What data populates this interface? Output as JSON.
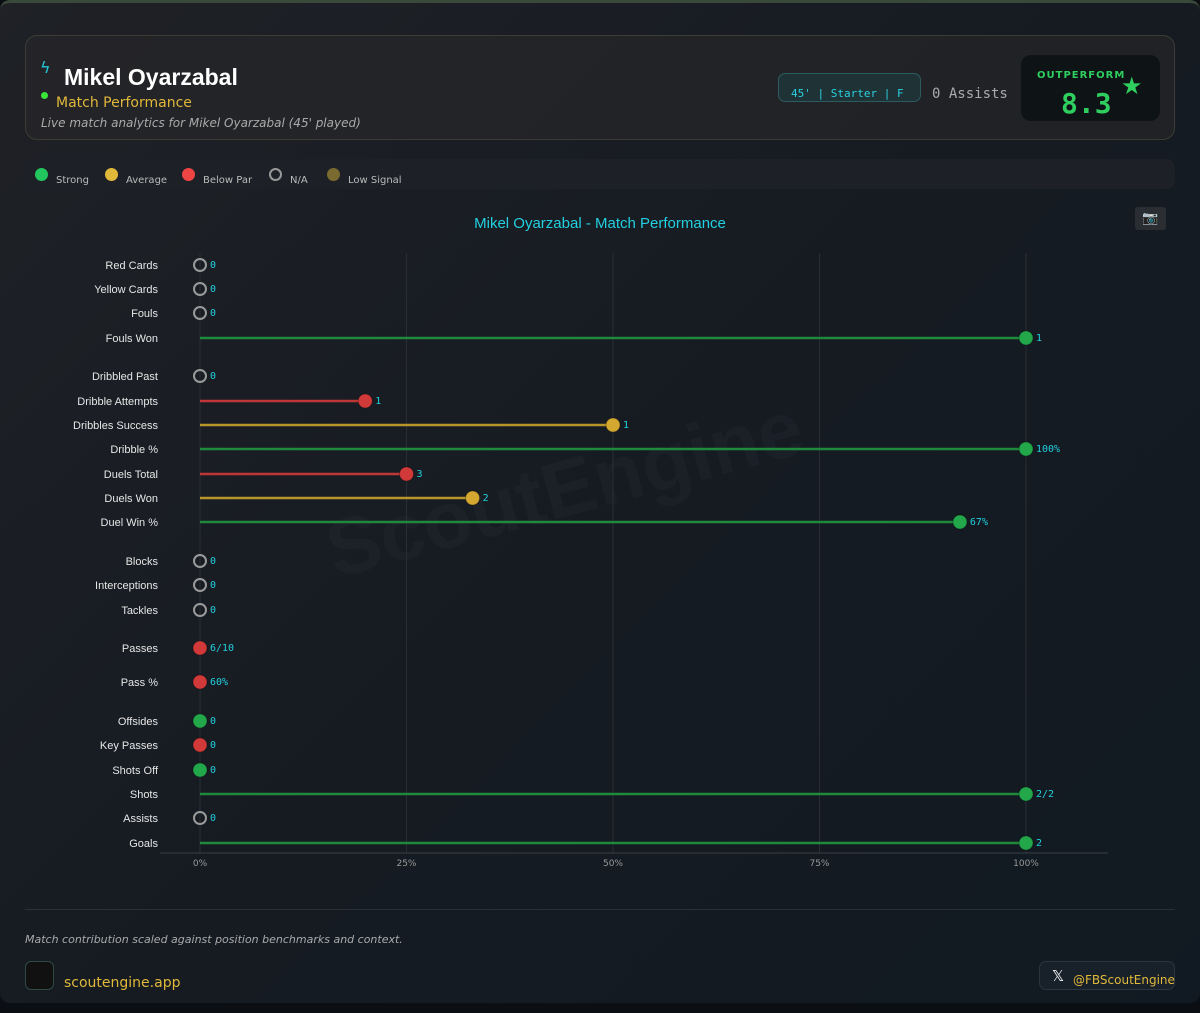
{
  "header": {
    "player": "Mikel Oyarzabal",
    "subtitle": "Match Performance",
    "description": "Live match analytics for Mikel Oyarzabal (45' played)",
    "badge": "45' | Starter | F",
    "assists": "0 Assists",
    "rating_label": "OUTPERFORM",
    "rating": "8.3",
    "icons": [
      "bolt-icon",
      "star-icon"
    ]
  },
  "legend": [
    {
      "label": "Strong",
      "color": "#22c55e"
    },
    {
      "label": "Average",
      "color": "#e0b83a"
    },
    {
      "label": "Below Par",
      "color": "#ef4444"
    },
    {
      "label": "N/A",
      "color": "hollow"
    },
    {
      "label": "Low Signal",
      "color": "#7a6a30"
    }
  ],
  "chart_data": {
    "type": "lollipop",
    "title": "Mikel Oyarzabal - Match Performance",
    "xlim": [
      0,
      100
    ],
    "xticks": [
      "0%",
      "25%",
      "50%",
      "75%",
      "100%"
    ],
    "grid": true,
    "rows": [
      {
        "label": "Red Cards",
        "pct": 0,
        "text": "0",
        "status": "na"
      },
      {
        "label": "Yellow Cards",
        "pct": 0,
        "text": "0",
        "status": "na"
      },
      {
        "label": "Fouls",
        "pct": 0,
        "text": "0",
        "status": "na"
      },
      {
        "label": "Fouls Won",
        "pct": 100,
        "text": "1",
        "status": "strong"
      },
      {
        "label": "Dribbled Past",
        "pct": 0,
        "text": "0",
        "status": "na"
      },
      {
        "label": "Dribble Attempts",
        "pct": 20,
        "text": "1",
        "status": "below"
      },
      {
        "label": "Dribbles Success",
        "pct": 50,
        "text": "1",
        "status": "average"
      },
      {
        "label": "Dribble %",
        "pct": 100,
        "text": "100%",
        "status": "strong"
      },
      {
        "label": "Duels Total",
        "pct": 25,
        "text": "3",
        "status": "below"
      },
      {
        "label": "Duels Won",
        "pct": 33,
        "text": "2",
        "status": "average"
      },
      {
        "label": "Duel Win %",
        "pct": 92,
        "text": "67%",
        "status": "strong"
      },
      {
        "label": "Blocks",
        "pct": 0,
        "text": "0",
        "status": "na"
      },
      {
        "label": "Interceptions",
        "pct": 0,
        "text": "0",
        "status": "na"
      },
      {
        "label": "Tackles",
        "pct": 0,
        "text": "0",
        "status": "na"
      },
      {
        "label": "Passes",
        "pct": 0,
        "text": "6/10",
        "status": "below"
      },
      {
        "label": "Pass %",
        "pct": 0,
        "text": "60%",
        "status": "below"
      },
      {
        "label": "Offsides",
        "pct": 0,
        "text": "0",
        "status": "strong"
      },
      {
        "label": "Key Passes",
        "pct": 0,
        "text": "0",
        "status": "below"
      },
      {
        "label": "Shots Off",
        "pct": 0,
        "text": "0",
        "status": "strong"
      },
      {
        "label": "Shots",
        "pct": 100,
        "text": "2/2",
        "status": "strong"
      },
      {
        "label": "Assists",
        "pct": 0,
        "text": "0",
        "status": "na"
      },
      {
        "label": "Goals",
        "pct": 100,
        "text": "2",
        "status": "strong"
      }
    ]
  },
  "watermark": "ScoutEngine",
  "footer": {
    "note": "Match contribution scaled against position benchmarks and context.",
    "site": "scoutengine.app",
    "x_handle": "@FBScoutEngine"
  }
}
